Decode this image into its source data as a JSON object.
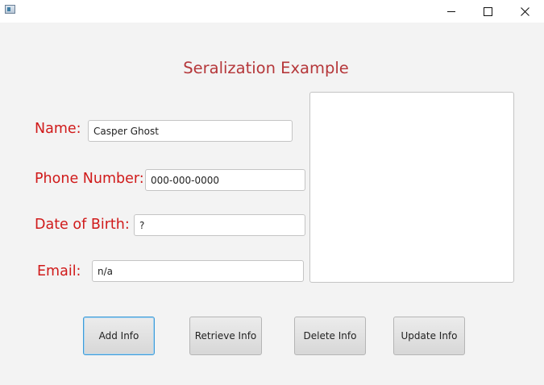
{
  "window": {
    "app_icon": "java-window-icon",
    "controls": {
      "minimize": "minimize-icon",
      "maximize": "maximize-icon",
      "close": "close-icon"
    }
  },
  "form": {
    "heading": "Seralization Example",
    "fields": {
      "name": {
        "label": "Name:",
        "value": "Casper Ghost"
      },
      "phone": {
        "label": "Phone Number:",
        "value": "000-000-0000"
      },
      "dob": {
        "label": "Date of Birth:",
        "value": "?"
      },
      "email": {
        "label": "Email:",
        "value": "n/a"
      }
    },
    "output_text": ""
  },
  "buttons": {
    "add": "Add Info",
    "retrieve": "Retrieve Info",
    "delete": "Delete Info",
    "update": "Update Info"
  },
  "colors": {
    "heading": "#b5373a",
    "labels": "#d01a1a",
    "focus_border": "#3d9bd8",
    "background": "#f3f3f3"
  }
}
